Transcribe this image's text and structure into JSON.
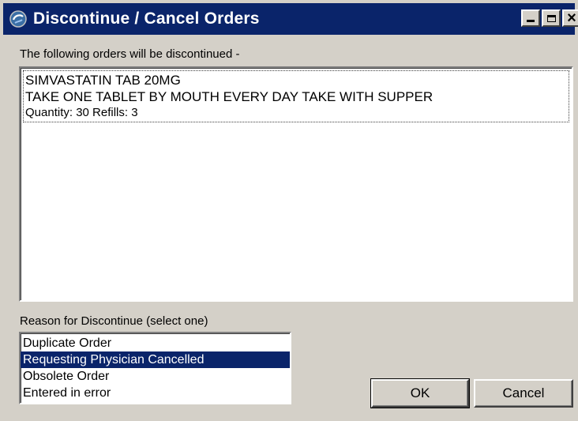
{
  "window": {
    "title": "Discontinue / Cancel Orders",
    "icon": "app-icon"
  },
  "orders": {
    "label": "The following orders will be discontinued -",
    "items": [
      {
        "line1": "SIMVASTATIN TAB  20MG",
        "line2": "TAKE ONE TABLET BY MOUTH EVERY DAY TAKE WITH SUPPER",
        "line3": "Quantity: 30 Refills: 3"
      }
    ]
  },
  "reason": {
    "label": "Reason for Discontinue (select one)",
    "options": [
      "Duplicate Order",
      "Requesting Physician Cancelled",
      "Obsolete Order",
      "Entered in error"
    ],
    "selected": "Requesting Physician Cancelled"
  },
  "buttons": {
    "ok": "OK",
    "cancel": "Cancel"
  },
  "colors": {
    "titlebar": "#0a246a",
    "selection": "#0a246a",
    "face": "#d4d0c8"
  }
}
